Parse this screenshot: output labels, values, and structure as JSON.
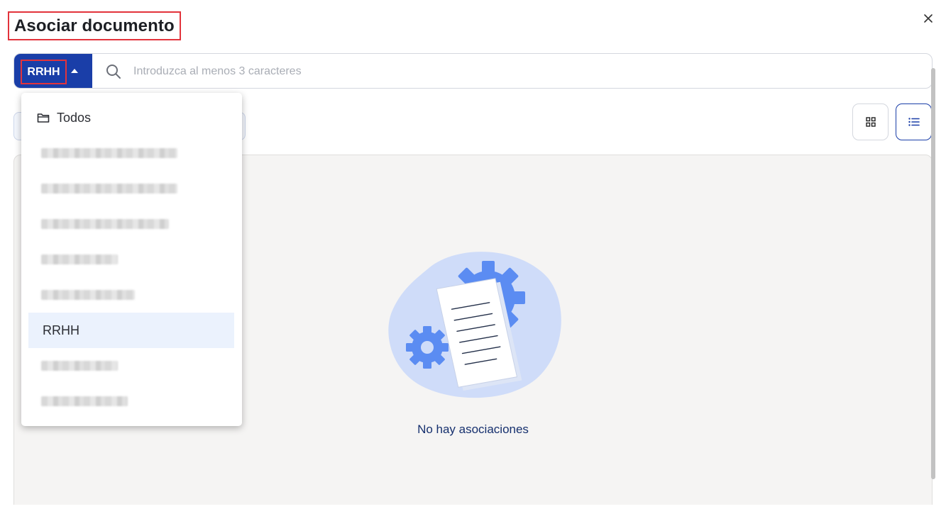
{
  "dialog": {
    "title": "Asociar documento",
    "close_icon": "close-icon"
  },
  "search": {
    "category_selected": "RRHH",
    "placeholder": "Introduzca al menos 3 caracteres",
    "value": ""
  },
  "dropdown": {
    "items": [
      {
        "label": "Todos",
        "icon": "folder-icon",
        "obscured": false,
        "selected": false
      },
      {
        "label": "",
        "obscured": true,
        "selected": false
      },
      {
        "label": "",
        "obscured": true,
        "selected": false
      },
      {
        "label": "",
        "obscured": true,
        "selected": false
      },
      {
        "label": "",
        "obscured": true,
        "selected": false
      },
      {
        "label": "",
        "obscured": true,
        "selected": false
      },
      {
        "label": "RRHH",
        "obscured": false,
        "selected": true
      },
      {
        "label": "",
        "obscured": true,
        "selected": false
      },
      {
        "label": "",
        "obscured": true,
        "selected": false
      }
    ]
  },
  "view_toggle": {
    "grid_icon": "grid-view-icon",
    "list_icon": "list-view-icon",
    "active": "list"
  },
  "empty_state": {
    "message": "No hay asociaciones",
    "illustration": "document-gears-illustration"
  },
  "colors": {
    "primary": "#1a3ea8",
    "highlight_border": "#e2333b",
    "selected_item_bg": "#ebf2fd",
    "content_bg": "#f5f4f3",
    "illustration_blob": "#cfdcf9",
    "illustration_gear": "#5b8cf2"
  }
}
